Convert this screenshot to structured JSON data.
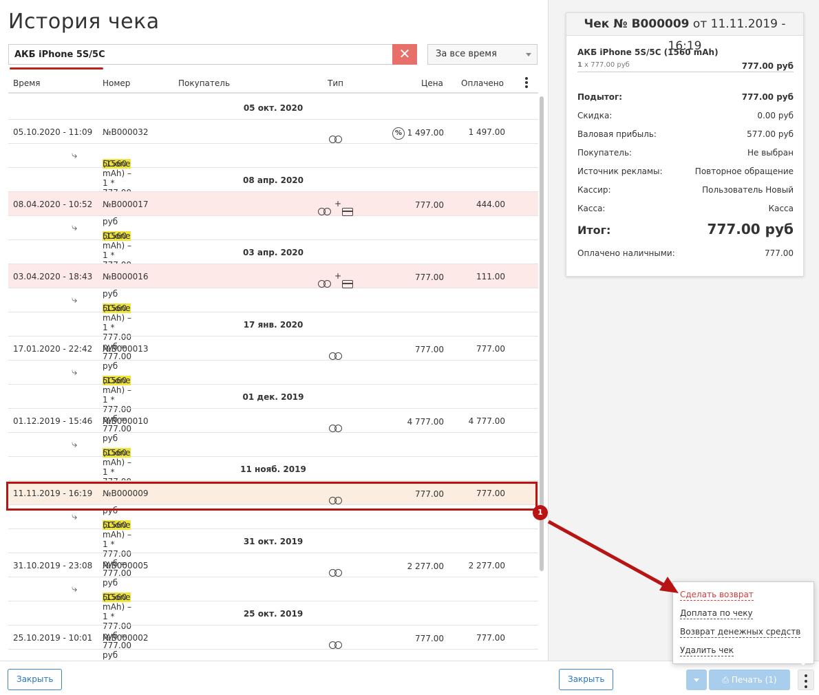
{
  "page_title": "История чека",
  "search": {
    "value": "АКБ iPhone 5S/5C"
  },
  "period": {
    "selected": "За все время"
  },
  "columns": {
    "time": "Время",
    "number": "Номер",
    "buyer": "Покупатель",
    "type": "Тип",
    "price": "Цена",
    "paid": "Оплачено"
  },
  "item_text": {
    "a": "АКБ",
    "b": "iPhone",
    "c": "5S",
    "d": "/",
    "e": "5C",
    "rest": " (1560 mAh) – 1 * 777.00 руб = 777.00 руб"
  },
  "groups": [
    {
      "date": "05 окт. 2020",
      "time": "05.10.2020 - 11:09",
      "number": "№B000032",
      "price": "1 497.00",
      "paid": "1 497.00",
      "card": false,
      "discount": true
    },
    {
      "date": "08 апр. 2020",
      "time": "08.04.2020 - 10:52",
      "number": "№B000017",
      "price": "777.00",
      "paid": "444.00",
      "card": true,
      "discount": false
    },
    {
      "date": "03 апр. 2020",
      "time": "03.04.2020 - 18:43",
      "number": "№B000016",
      "price": "777.00",
      "paid": "111.00",
      "card": true,
      "discount": false
    },
    {
      "date": "17 янв. 2020",
      "time": "17.01.2020 - 22:42",
      "number": "№B000013",
      "price": "777.00",
      "paid": "777.00",
      "card": false,
      "discount": false
    },
    {
      "date": "01 дек. 2019",
      "time": "01.12.2019 - 15:46",
      "number": "№B000010",
      "price": "4 777.00",
      "paid": "4 777.00",
      "card": false,
      "discount": false
    },
    {
      "date": "11 нояб. 2019",
      "time": "11.11.2019 - 16:19",
      "number": "№B000009",
      "price": "777.00",
      "paid": "777.00",
      "card": false,
      "discount": false
    },
    {
      "date": "31 окт. 2019",
      "time": "31.10.2019 - 23:08",
      "number": "№B000005",
      "price": "2 277.00",
      "paid": "2 277.00",
      "card": false,
      "discount": false
    },
    {
      "date": "25 окт. 2019",
      "time": "25.10.2019 - 10:01",
      "number": "№B000002",
      "price": "777.00",
      "paid": "777.00",
      "card": false,
      "discount": false
    }
  ],
  "close_label": "Закрыть",
  "badge": "1",
  "receipt": {
    "title_prefix": "Чек № B000009",
    "title_suffix": " от 11.11.2019 - 16:19",
    "item_name": "АКБ iPhone 5S/5C (1560 mAh)",
    "item_qty": "1",
    "item_unit": " x 777.00 руб",
    "item_total": "777.00 руб",
    "lines": [
      {
        "label": "Подытог:",
        "value": "777.00 руб"
      },
      {
        "label": "Скидка:",
        "value": "0.00 руб"
      },
      {
        "label": "Валовая прибыль:",
        "value": "577.00 руб"
      },
      {
        "label": "Покупатель:",
        "value": "Не выбран"
      },
      {
        "label": "Источник рекламы:",
        "value": "Повторное обращение"
      },
      {
        "label": "Кассир:",
        "value": "Пользователь Новый"
      },
      {
        "label": "Касса:",
        "value": "Касса"
      }
    ],
    "total_label": "Итог:",
    "total_value": "777.00 руб",
    "cash_label": "Оплачено наличными:",
    "cash_value": "777.00"
  },
  "print_label": "Печать (1)",
  "menu": [
    "Сделать возврат",
    "Доплата по чеку",
    "Возврат денежных средств",
    "Удалить чек"
  ]
}
